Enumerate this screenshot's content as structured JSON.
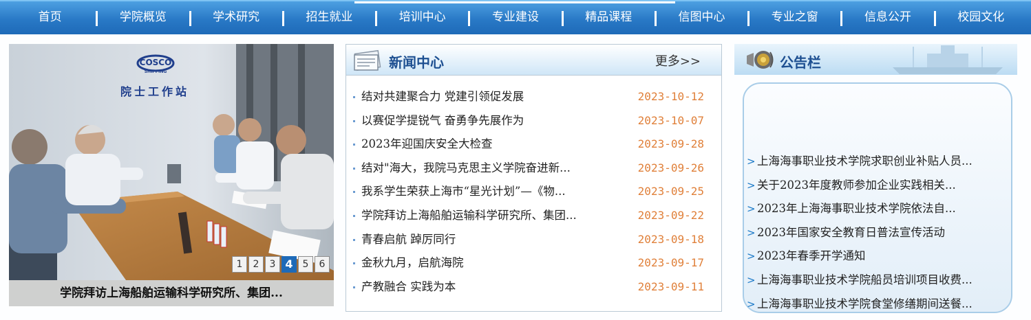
{
  "nav": {
    "items": [
      "首页",
      "学院概览",
      "学术研究",
      "招生就业",
      "培训中心",
      "专业建设",
      "精品课程",
      "信图中心",
      "专业之窗",
      "信息公开",
      "校园文化"
    ]
  },
  "slideshow": {
    "photo_text": {
      "logo_line1": "COSCO",
      "logo_line2": "SHIPPING",
      "wall_sign": "院士工作站"
    },
    "pages": [
      "1",
      "2",
      "3",
      "4",
      "5",
      "6"
    ],
    "current_page": 4,
    "caption": "学院拜访上海船舶运输科学研究所、集团..."
  },
  "news": {
    "title": "新闻中心",
    "more": "更多>>",
    "items": [
      {
        "title": "结对共建聚合力 党建引领促发展",
        "date": "2023-10-12"
      },
      {
        "title": "以赛促学提锐气 奋勇争先展作为",
        "date": "2023-10-07"
      },
      {
        "title": "2023年迎国庆安全大检查",
        "date": "2023-09-28"
      },
      {
        "title": "结对\"海大，我院马克思主义学院奋进新...",
        "date": "2023-09-26"
      },
      {
        "title": "我系学生荣获上海市“星光计划”—《物...",
        "date": "2023-09-25"
      },
      {
        "title": "学院拜访上海船舶运输科学研究所、集团...",
        "date": "2023-09-22"
      },
      {
        "title": "青春启航 踔厉同行",
        "date": "2023-09-18"
      },
      {
        "title": "金秋九月，启航海院",
        "date": "2023-09-17"
      },
      {
        "title": "产教融合 实践为本",
        "date": "2023-09-11"
      }
    ]
  },
  "notice": {
    "title": "公告栏",
    "items": [
      "上海海事职业技术学院求职创业补贴人员...",
      "关于2023年度教师参加企业实践相关...",
      "2023年上海海事职业技术学院依法自...",
      "2023年国家安全教育日普法宣传活动",
      "2023年春季开学通知",
      "上海海事职业技术学院船员培训项目收费...",
      "上海海事职业技术学院食堂修缮期间送餐..."
    ]
  }
}
